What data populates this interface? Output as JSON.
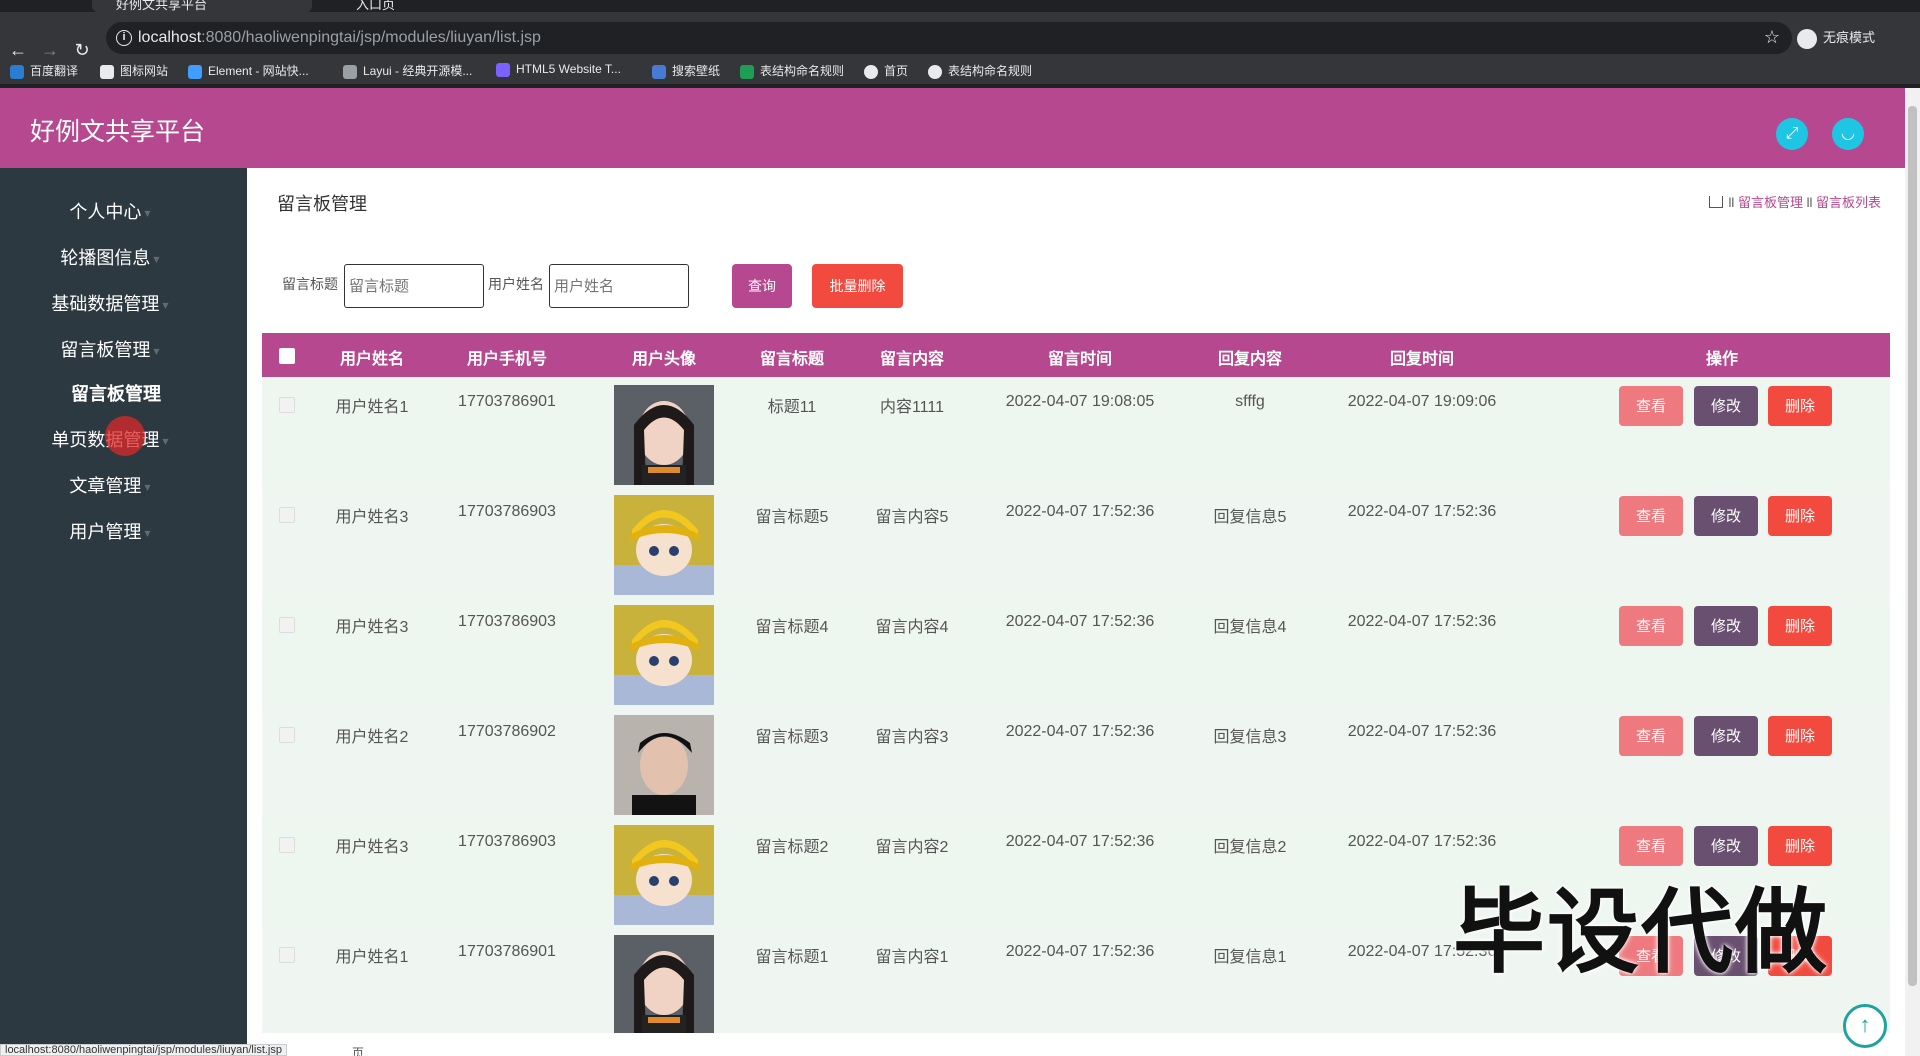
{
  "browser": {
    "tabs": [
      {
        "title": "好例文共享平台",
        "active": true
      },
      {
        "title": "入口页",
        "active": false
      }
    ],
    "url_host": "localhost",
    "url_path": ":8080/haoliwenpingtai/jsp/modules/liuyan/list.jsp",
    "incognito_label": "无痕模式",
    "bookmarks": [
      "百度翻译",
      "图标网站",
      "Element - 网站快...",
      "Layui - 经典开源模...",
      "HTML5 Website T...",
      "搜索壁纸",
      "表结构命名规则",
      "首页",
      "表结构命名规则"
    ],
    "status_url": "localhost:8080/haoliwenpingtai/jsp/modules/liuyan/list.jsp"
  },
  "app": {
    "title": "好例文共享平台",
    "accent_color": "#b5488f"
  },
  "sidebar": {
    "items": [
      "个人中心",
      "轮播图信息",
      "基础数据管理",
      "留言板管理",
      "单页数据管理",
      "文章管理",
      "用户管理"
    ],
    "sub_item": "留言板管理"
  },
  "main": {
    "page_title": "留言板管理",
    "breadcrumb": [
      "留言板管理",
      "留言板列表"
    ],
    "breadcrumb_sep": "ll",
    "search": {
      "title_label": "留言标题",
      "title_placeholder": "留言标题",
      "name_label": "用户姓名",
      "name_placeholder": "用户姓名",
      "query_button": "查询",
      "batch_delete_button": "批量删除"
    },
    "table": {
      "headers": [
        "用户姓名",
        "用户手机号",
        "用户头像",
        "留言标题",
        "留言内容",
        "留言时间",
        "回复内容",
        "回复时间",
        "操作"
      ],
      "actions": {
        "view": "查看",
        "edit": "修改",
        "delete": "删除"
      },
      "rows": [
        {
          "name": "用户姓名1",
          "phone": "17703786901",
          "avatar": "girl",
          "title": "标题11",
          "content": "内容1111",
          "time": "2022-04-07 19:08:05",
          "reply": "sfffg",
          "reply_time": "2022-04-07 19:09:06"
        },
        {
          "name": "用户姓名3",
          "phone": "17703786903",
          "avatar": "cartoon-boy",
          "title": "留言标题5",
          "content": "留言内容5",
          "time": "2022-04-07 17:52:36",
          "reply": "回复信息5",
          "reply_time": "2022-04-07 17:52:36"
        },
        {
          "name": "用户姓名3",
          "phone": "17703786903",
          "avatar": "cartoon-boy",
          "title": "留言标题4",
          "content": "留言内容4",
          "time": "2022-04-07 17:52:36",
          "reply": "回复信息4",
          "reply_time": "2022-04-07 17:52:36"
        },
        {
          "name": "用户姓名2",
          "phone": "17703786902",
          "avatar": "man",
          "title": "留言标题3",
          "content": "留言内容3",
          "time": "2022-04-07 17:52:36",
          "reply": "回复信息3",
          "reply_time": "2022-04-07 17:52:36"
        },
        {
          "name": "用户姓名3",
          "phone": "17703786903",
          "avatar": "cartoon-boy",
          "title": "留言标题2",
          "content": "留言内容2",
          "time": "2022-04-07 17:52:36",
          "reply": "回复信息2",
          "reply_time": "2022-04-07 17:52:36"
        },
        {
          "name": "用户姓名1",
          "phone": "17703786901",
          "avatar": "girl",
          "title": "留言标题1",
          "content": "留言内容1",
          "time": "2022-04-07 17:52:36",
          "reply": "回复信息1",
          "reply_time": "2022-04-07 17:52:36"
        }
      ]
    },
    "pager_suffix": "页"
  },
  "watermark": "毕设代做"
}
